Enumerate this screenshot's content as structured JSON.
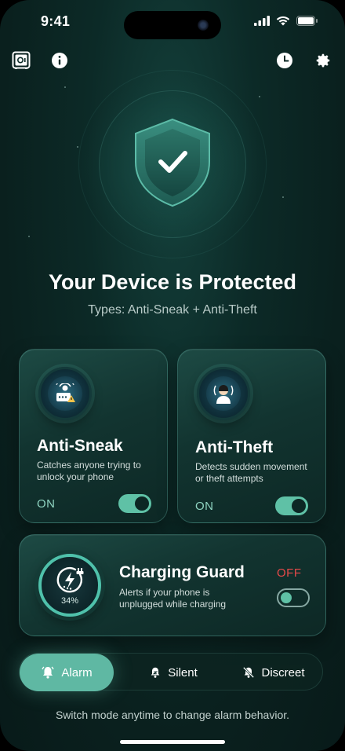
{
  "status_bar": {
    "time": "9:41"
  },
  "top_bar": {
    "left_icons": [
      "safe-icon",
      "info-icon"
    ],
    "right_icons": [
      "clock-icon",
      "gear-icon"
    ]
  },
  "hero": {
    "title": "Your Device is Protected",
    "subtitle": "Types: Anti-Sneak + Anti-Theft"
  },
  "cards": {
    "anti_sneak": {
      "name": "Anti-Sneak",
      "desc_line1": "Catches anyone trying to",
      "desc_line2": "unlock your phone",
      "state": "ON",
      "enabled": true
    },
    "anti_theft": {
      "name": "Anti-Theft",
      "desc_line1": "Detects sudden movement",
      "desc_line2": "or theft attempts",
      "state": "ON",
      "enabled": true
    },
    "charging_guard": {
      "name": "Charging Guard",
      "desc_line1": "Alerts if your phone is",
      "desc_line2": "unplugged while charging",
      "state": "OFF",
      "enabled": false,
      "battery": "34%"
    }
  },
  "modes": {
    "items": [
      {
        "label": "Alarm",
        "icon": "alarm-bell-icon",
        "active": true
      },
      {
        "label": "Silent",
        "icon": "silent-bell-icon",
        "active": false
      },
      {
        "label": "Discreet",
        "icon": "bell-off-icon",
        "active": false
      }
    ]
  },
  "footer": "Switch mode anytime to change alarm behavior.",
  "colors": {
    "accent": "#5fc1a6",
    "off_state": "#e84a4a",
    "on_state": "#8fd4c1",
    "background": "#0c2a27"
  }
}
